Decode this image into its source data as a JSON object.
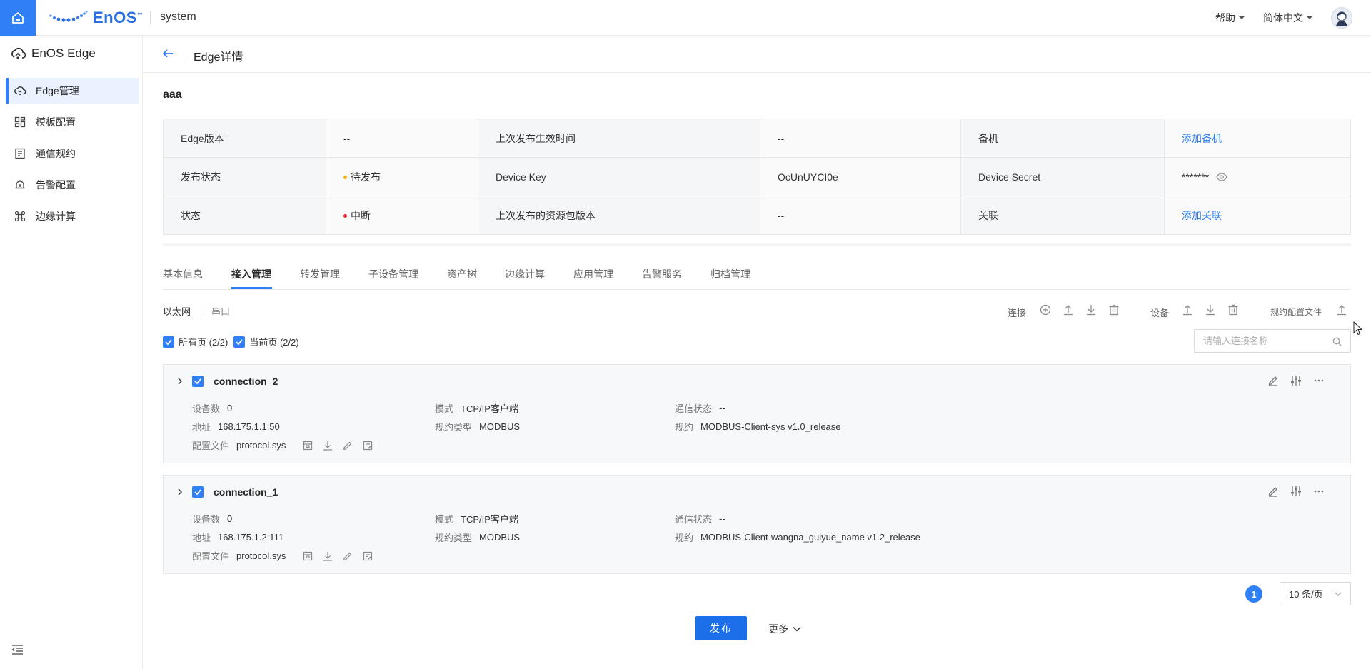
{
  "topbar": {
    "brand": "EnOS",
    "brand_tm": "™",
    "system": "system",
    "help": "帮助",
    "language": "简体中文"
  },
  "sidebar": {
    "title": "EnOS Edge",
    "items": [
      {
        "label": "Edge管理",
        "icon": "edge-manage-icon"
      },
      {
        "label": "模板配置",
        "icon": "grid-icon"
      },
      {
        "label": "通信规约",
        "icon": "document-icon"
      },
      {
        "label": "告警配置",
        "icon": "alarm-bell-icon"
      },
      {
        "label": "边缘计算",
        "icon": "compute-icon"
      }
    ]
  },
  "header": {
    "title": "Edge详情"
  },
  "device": {
    "name": "aaa",
    "info": {
      "edge_version_label": "Edge版本",
      "edge_version": "--",
      "last_publish_time_label": "上次发布生效时间",
      "last_publish_time": "--",
      "backup_label": "备机",
      "backup_link": "添加备机",
      "publish_status_label": "发布状态",
      "publish_status": "待发布",
      "device_key_label": "Device Key",
      "device_key": "OcUnUYCI0e",
      "device_secret_label": "Device Secret",
      "device_secret": "*******",
      "status_label": "状态",
      "status": "中断",
      "last_resource_version_label": "上次发布的资源包版本",
      "last_resource_version": "--",
      "relation_label": "关联",
      "relation_link": "添加关联"
    },
    "colors": {
      "pending": "#faad14",
      "interrupted": "#f5222d",
      "accent": "#2f80f6"
    }
  },
  "tabs": [
    "基本信息",
    "接入管理",
    "转发管理",
    "子设备管理",
    "资产树",
    "边缘计算",
    "应用管理",
    "告警服务",
    "归档管理"
  ],
  "active_tab": "接入管理",
  "subtabs": {
    "ethernet": "以太网",
    "serial": "串口"
  },
  "toolbar": {
    "connection_label": "连接",
    "device_label": "设备",
    "protocol_file_label": "规约配置文件"
  },
  "selection": {
    "all_pages": "所有页 (2/2)",
    "current_page": "当前页 (2/2)"
  },
  "search": {
    "placeholder": "请输入连接名称"
  },
  "connections": [
    {
      "name": "connection_2",
      "device_count_label": "设备数",
      "device_count": "0",
      "mode_label": "模式",
      "mode": "TCP/IP客户端",
      "comm_status_label": "通信状态",
      "comm_status": "--",
      "address_label": "地址",
      "address": "168.175.1.1:50",
      "protocol_type_label": "规约类型",
      "protocol_type": "MODBUS",
      "protocol_label": "规约",
      "protocol": "MODBUS-Client-sys v1.0_release",
      "config_file_label": "配置文件",
      "config_file": "protocol.sys"
    },
    {
      "name": "connection_1",
      "device_count_label": "设备数",
      "device_count": "0",
      "mode_label": "模式",
      "mode": "TCP/IP客户端",
      "comm_status_label": "通信状态",
      "comm_status": "--",
      "address_label": "地址",
      "address": "168.175.1.2:111",
      "protocol_type_label": "规约类型",
      "protocol_type": "MODBUS",
      "protocol_label": "规约",
      "protocol": "MODBUS-Client-wangna_guiyue_name v1.2_release",
      "config_file_label": "配置文件",
      "config_file": "protocol.sys"
    }
  ],
  "pagination": {
    "current_page": "1",
    "page_size": "10 条/页"
  },
  "footer": {
    "publish": "发布",
    "more": "更多"
  }
}
